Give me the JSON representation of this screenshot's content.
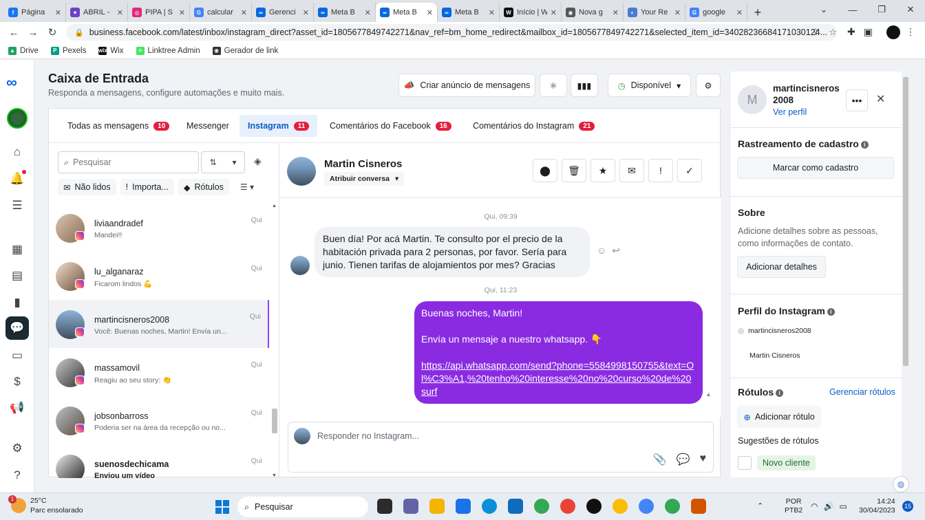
{
  "browser": {
    "tabs": [
      {
        "label": "Página",
        "color": "#1877f2",
        "glyph": "f"
      },
      {
        "label": "ABRIL -",
        "color": "#6b42ca",
        "glyph": "♥"
      },
      {
        "label": "PIPA | S",
        "color": "#dd2a7b",
        "glyph": "◎"
      },
      {
        "label": "calcular",
        "color": "#4285f4",
        "glyph": "G"
      },
      {
        "label": "Gerenci",
        "color": "#0668e1",
        "glyph": "∞"
      },
      {
        "label": "Meta B",
        "color": "#0668e1",
        "glyph": "∞"
      },
      {
        "label": "Meta B",
        "color": "#0668e1",
        "glyph": "∞"
      },
      {
        "label": "Meta B",
        "color": "#0668e1",
        "glyph": "∞"
      },
      {
        "label": "Início | W",
        "color": "#111111",
        "glyph": "W"
      },
      {
        "label": "Nova g",
        "color": "#555555",
        "glyph": "◉"
      },
      {
        "label": "Your Re",
        "color": "#4a7bd0",
        "glyph": "◐"
      },
      {
        "label": "google",
        "color": "#4285f4",
        "glyph": "G"
      }
    ],
    "url": "business.facebook.com/latest/inbox/instagram_direct?asset_id=1805677849742271&nav_ref=bm_home_redirect&mailbox_id=1805677849742271&selected_item_id=34028236684171030124...",
    "bookmarks": [
      {
        "label": "Drive",
        "color": "#1fa463",
        "glyph": "▲"
      },
      {
        "label": "Pexels",
        "color": "#05a081",
        "glyph": "P"
      },
      {
        "label": "Wix",
        "color": "#111111",
        "glyph": "wix"
      },
      {
        "label": "Linktree Admin",
        "color": "#43e55e",
        "glyph": "✳"
      },
      {
        "label": "Gerador de link",
        "color": "#333333",
        "glyph": "◉"
      }
    ]
  },
  "header": {
    "title": "Caixa de Entrada",
    "subtitle": "Responda a mensagens, configure automações e muito mais.",
    "create_ad": "Criar anúncio de mensagens",
    "status": "Disponível"
  },
  "inbox_tabs": [
    {
      "label": "Todas as mensagens",
      "count": "10"
    },
    {
      "label": "Messenger",
      "count": ""
    },
    {
      "label": "Instagram",
      "count": "11"
    },
    {
      "label": "Comentários do Facebook",
      "count": "16"
    },
    {
      "label": "Comentários do Instagram",
      "count": "21"
    }
  ],
  "list": {
    "search_placeholder": "Pesquisar",
    "filters": [
      "Não lidos",
      "Importa...",
      "Rótulos"
    ],
    "conversations": [
      {
        "name": "liviaandradef",
        "preview": "Mandei!!",
        "time": "Qui",
        "bold": false
      },
      {
        "name": "lu_alganaraz",
        "preview": "Ficarom lindos 💪",
        "time": "Qui",
        "bold": false
      },
      {
        "name": "martincisneros2008",
        "preview": "Você: Buenas noches, Martin! Envía un...",
        "time": "Qui",
        "bold": false
      },
      {
        "name": "massamovil",
        "preview": "Reagiu ao seu story: 👏",
        "time": "Qui",
        "bold": false
      },
      {
        "name": "jobsonbarross",
        "preview": "Poderia ser na área da recepção ou no...",
        "time": "Qui",
        "bold": false
      },
      {
        "name": "suenosdechicama",
        "preview": "Enviou um vídeo",
        "time": "Qui",
        "bold": true
      }
    ]
  },
  "chat": {
    "name": "Martin Cisneros",
    "assign": "Atribuir conversa",
    "stamp1": "Qui, 09:39",
    "incoming": "Buen día! Por acá Martin. Te consulto por el precio de la habitación privada para 2 personas, por favor. Sería para junio. Tienen tarifas de alojamientos por mes? Gracias",
    "stamp2": "Qui, 11:23",
    "outgoing_line1": "Buenas noches, Martin!",
    "outgoing_line2": "Envía un mensaje a nuestro whatsapp. 👇",
    "outgoing_link": "https://api.whatsapp.com/send?phone=5584998150755&text=Ol%C3%A1,%20tenho%20interesse%20no%20curso%20de%20surf",
    "composer_placeholder": "Responder no Instagram..."
  },
  "panel": {
    "avatar_letter": "M",
    "name": "martincisneros 2008",
    "view_profile": "Ver perfil",
    "tracking_title": "Rastreamento de cadastro",
    "mark_lead": "Marcar como cadastro",
    "about_title": "Sobre",
    "about_text": "Adicione detalhes sobre as pessoas, como informações de contato.",
    "add_details": "Adicionar detalhes",
    "ig_title": "Perfil do Instagram",
    "ig_handle": "martincisneros2008",
    "ig_name": "Martin Cisneros",
    "labels_title": "Rótulos",
    "manage_labels": "Gerenciar rótulos",
    "add_label": "Adicionar rótulo",
    "suggestions": "Sugestões de rótulos",
    "new_client": "Novo cliente"
  },
  "taskbar": {
    "temp": "25°C",
    "weather": "Parc ensolarado",
    "weather_badge": "1",
    "search": "Pesquisar",
    "lang1": "POR",
    "lang2": "PTB2",
    "time": "14:24",
    "date": "30/04/2023",
    "notif": "15"
  }
}
